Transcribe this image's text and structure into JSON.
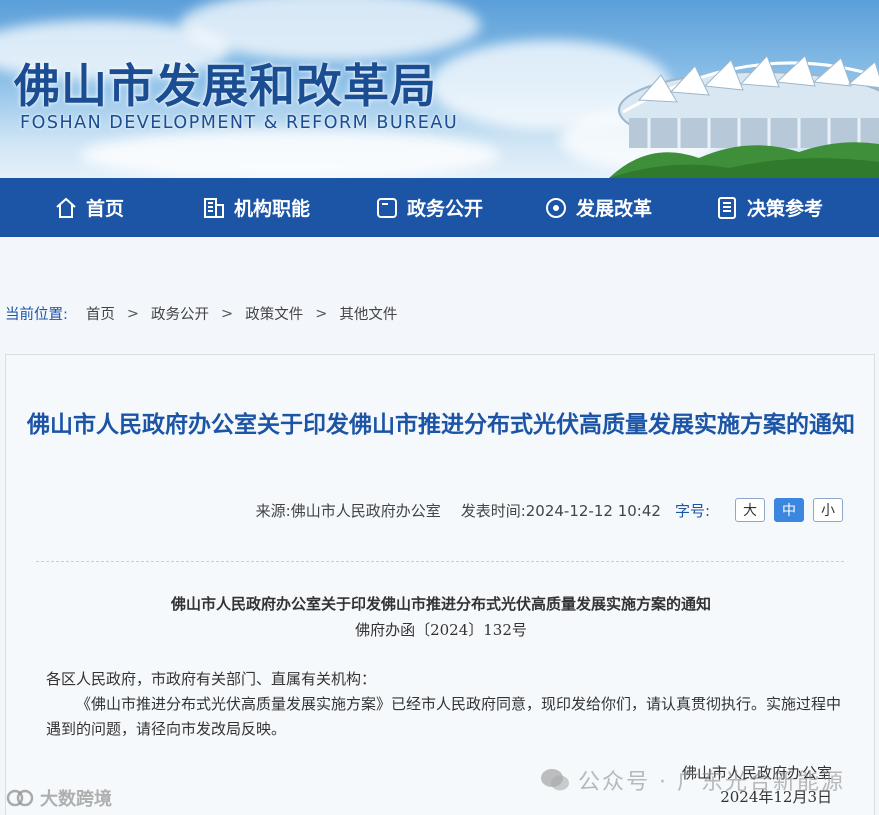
{
  "banner": {
    "title": "佛山市发展和改革局",
    "subtitle": "FOSHAN DEVELOPMENT & REFORM BUREAU"
  },
  "nav": {
    "items": [
      {
        "label": "首页",
        "icon": "home-icon"
      },
      {
        "label": "机构职能",
        "icon": "building-icon"
      },
      {
        "label": "政务公开",
        "icon": "square-icon"
      },
      {
        "label": "发展改革",
        "icon": "target-icon"
      },
      {
        "label": "决策参考",
        "icon": "document-icon"
      }
    ]
  },
  "breadcrumb": {
    "label": "当前位置:",
    "items": [
      "首页",
      "政务公开",
      "政策文件",
      "其他文件"
    ],
    "separator": ">"
  },
  "article": {
    "title": "佛山市人民政府办公室关于印发佛山市推进分布式光伏高质量发展实施方案的通知",
    "source": "来源:佛山市人民政府办公室",
    "publish_time": "发表时间:2024-12-12 10:42",
    "font_size_label": "字号:",
    "font_sizes": [
      "大",
      "中",
      "小"
    ],
    "font_size_selected": "中",
    "doc_title": "佛山市人民政府办公室关于印发佛山市推进分布式光伏高质量发展实施方案的通知",
    "doc_number": "佛府办函〔2024〕132号",
    "salutation": "各区人民政府，市政府有关部门、直属有关机构：",
    "paragraph": "《佛山市推进分布式光伏高质量发展实施方案》已经市人民政府同意，现印发给你们，请认真贯彻执行。实施过程中遇到的问题，请径向市发改局反映。",
    "signature": "佛山市人民政府办公室",
    "sign_date": "2024年12月3日"
  },
  "watermarks": {
    "left": "大数跨境",
    "right": "公众号 · 广东光合新能源"
  },
  "colors": {
    "nav_bg": "#1c54a6",
    "title_blue": "#1c54a6",
    "active_button": "#3b86e0"
  }
}
